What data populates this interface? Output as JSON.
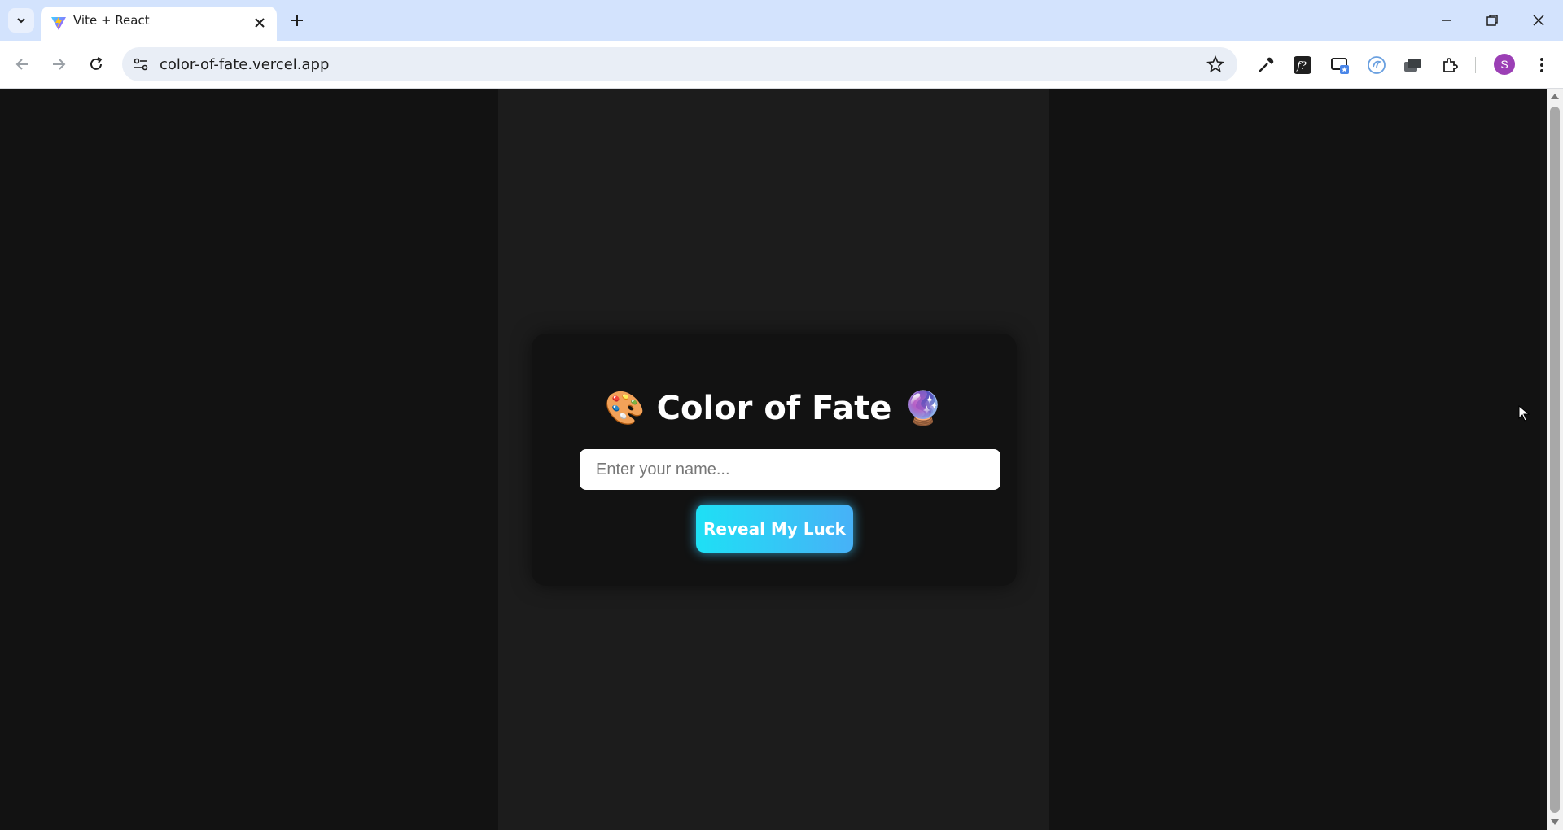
{
  "browser": {
    "tab_title": "Vite + React",
    "url": "color-of-fate.vercel.app",
    "profile_initial": "S"
  },
  "page": {
    "title": "🎨 Color of Fate 🔮",
    "name_placeholder": "Enter your name...",
    "reveal_button": "Reveal My Luck"
  },
  "colors": {
    "page_bg": "#121212",
    "column_bg": "#1c1c1c",
    "card_bg": "#121212",
    "button_gradient_start": "#1ee0f5",
    "button_gradient_end": "#47b1f7"
  }
}
